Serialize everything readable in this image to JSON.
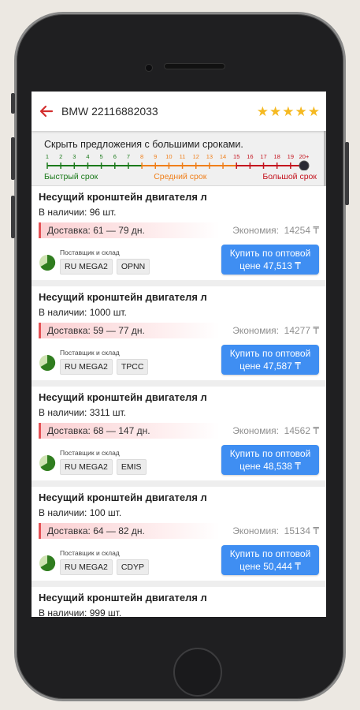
{
  "header": {
    "title": "BMW 22116882033",
    "rating_stars": 5
  },
  "filter": {
    "title": "Скрыть предложения с большими сроками.",
    "scale_ticks": [
      "1",
      "2",
      "3",
      "4",
      "5",
      "6",
      "7",
      "8",
      "9",
      "10",
      "11",
      "12",
      "13",
      "14",
      "15",
      "16",
      "17",
      "18",
      "19",
      "20+"
    ],
    "label_fast": "Быстрый срок",
    "label_mid": "Средний срок",
    "label_slow": "Большой срок",
    "selected": "20+"
  },
  "colors": {
    "fast": "#1b7a1b",
    "mid": "#ef7f1a",
    "slow": "#c4131e",
    "button": "#3f8ef2",
    "star": "#f5b921"
  },
  "offers": [
    {
      "title": "Несущий кронштейн двигателя л",
      "stock_label": "В наличии:",
      "stock_value": "96 шт.",
      "delivery_label": "Доставка:",
      "delivery_value": "61 — 79 дн.",
      "economy_label": "Экономия:",
      "economy_value": "14254 ₸",
      "supplier_label": "Поставщик и склад",
      "tags": [
        "RU MEGA2",
        "OPNN"
      ],
      "buy_line1": "Купить по оптовой",
      "buy_line2": "цене 47,513 ₸"
    },
    {
      "title": "Несущий кронштейн двигателя л",
      "stock_label": "В наличии:",
      "stock_value": "1000 шт.",
      "delivery_label": "Доставка:",
      "delivery_value": "59 — 77 дн.",
      "economy_label": "Экономия:",
      "economy_value": "14277 ₸",
      "supplier_label": "Поставщик и склад",
      "tags": [
        "RU MEGA2",
        "TPCC"
      ],
      "buy_line1": "Купить по оптовой",
      "buy_line2": "цене 47,587 ₸"
    },
    {
      "title": "Несущий кронштейн двигателя л",
      "stock_label": "В наличии:",
      "stock_value": "3311 шт.",
      "delivery_label": "Доставка:",
      "delivery_value": "68 — 147 дн.",
      "economy_label": "Экономия:",
      "economy_value": "14562 ₸",
      "supplier_label": "Поставщик и склад",
      "tags": [
        "RU MEGA2",
        "EMIS"
      ],
      "buy_line1": "Купить по оптовой",
      "buy_line2": "цене 48,538 ₸"
    },
    {
      "title": "Несущий кронштейн двигателя л",
      "stock_label": "В наличии:",
      "stock_value": "100 шт.",
      "delivery_label": "Доставка:",
      "delivery_value": "64 — 82 дн.",
      "economy_label": "Экономия:",
      "economy_value": "15134 ₸",
      "supplier_label": "Поставщик и склад",
      "tags": [
        "RU MEGA2",
        "CDYP"
      ],
      "buy_line1": "Купить по оптовой",
      "buy_line2": "цене 50,444 ₸"
    },
    {
      "title": "Несущий кронштейн двигателя л",
      "stock_label": "В наличии:",
      "stock_value": "999 шт."
    }
  ]
}
